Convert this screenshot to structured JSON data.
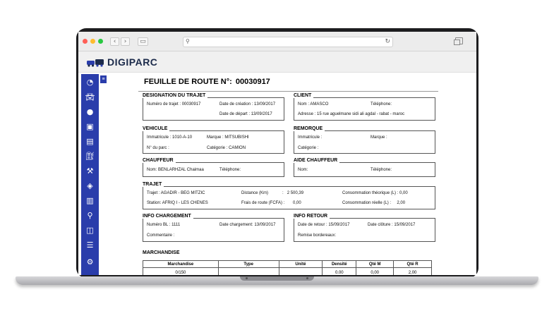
{
  "browser": {
    "address_value": "",
    "address_placeholder": ""
  },
  "app": {
    "logo_text": "DIGIPARC"
  },
  "colors": {
    "sidebar": "#2a3dab",
    "brand": "#1b2a4a"
  },
  "sidebar_icons": [
    "tachometer-icon",
    "car-icon",
    "user-icon",
    "bus-icon",
    "document-icon",
    "fuel-icon",
    "wrench-icon",
    "layers-icon",
    "building-icon",
    "map-marker-icon",
    "vehicle-icon",
    "list-icon",
    "gear-icon"
  ],
  "page": {
    "title": "FEUILLE DE ROUTE N°:",
    "number": "00030917"
  },
  "designation": {
    "title": "DESIGNATION DU TRAJET",
    "num_label": "Numéro de trajet :",
    "num_value": "00030917",
    "creation_label": "Date de création :",
    "creation_value": "13/09/2017",
    "depart_label": "Date de départ :",
    "depart_value": "13/09/2017"
  },
  "client": {
    "title": "CLIENT",
    "nom_label": "Nom :",
    "nom_value": "AMASCO",
    "tel_label": "Téléphone:",
    "adresse_label": "Adresse :",
    "adresse_value": "15 rue aguelmane sidi ali agdal - rabat - maroc"
  },
  "vehicule": {
    "title": "VEHICULE",
    "immat_label": "Immatricule :",
    "immat_value": "1010-A-10",
    "marque_label": "Marque :",
    "marque_value": "MITSUBISHI",
    "parc_label": "N° du parc :",
    "categorie_label": "Catégorie :",
    "categorie_value": "CAMION"
  },
  "remorque": {
    "title": "REMORQUE",
    "immat_label": "Immatricule :",
    "marque_label": "Marque :",
    "categorie_label": "Catégorie :"
  },
  "chauffeur": {
    "title": "CHAUFFEUR",
    "nom_label": "Nom:",
    "nom_value": "BENLARHZAL Chaimaa",
    "tel_label": "Téléphone:"
  },
  "aide": {
    "title": "AIDE CHAUFFEUR",
    "nom_label": "Nom:",
    "tel_label": "Téléphone:"
  },
  "trajet": {
    "title": "TRAJET",
    "trajet_label": "Trajet :",
    "trajet_value": "AGADIR - BEG MITZIC",
    "station_label": "Station:",
    "station_value": "AFRIQ I - LES CHENES",
    "distance_label": "Distance (Km)",
    "distance_sep": ":",
    "distance_value": "2 500,39",
    "frais_label": "Frais de route (FCFA) :",
    "frais_value": "0,00",
    "conso_theo_label": "Consommation théorique (L) :",
    "conso_theo_value": "0,00",
    "conso_reelle_label": "Consommation réelle (L) :",
    "conso_reelle_value": "2,00"
  },
  "info_chargement": {
    "title": "INFO CHARGEMENT",
    "bl_label": "Numéro BL :",
    "bl_value": "1111",
    "date_label": "Date chargement:",
    "date_value": "13/09/2017",
    "comment_label": "Commentaire :"
  },
  "info_retour": {
    "title": "INFO RETOUR",
    "retour_label": "Date de retour :",
    "retour_value": "15/09/2017",
    "cloture_label": "Date clôture :",
    "cloture_value": "15/09/2017",
    "remise_label": "Remise bordereaux:"
  },
  "marchandise": {
    "title": "MARCHANDISE",
    "headers": [
      "Marchandise",
      "Type",
      "Unité",
      "Densité",
      "Qté M",
      "Qté R"
    ],
    "row": [
      "0/150",
      "",
      "",
      "0.00",
      "0,00",
      "2,00"
    ]
  }
}
